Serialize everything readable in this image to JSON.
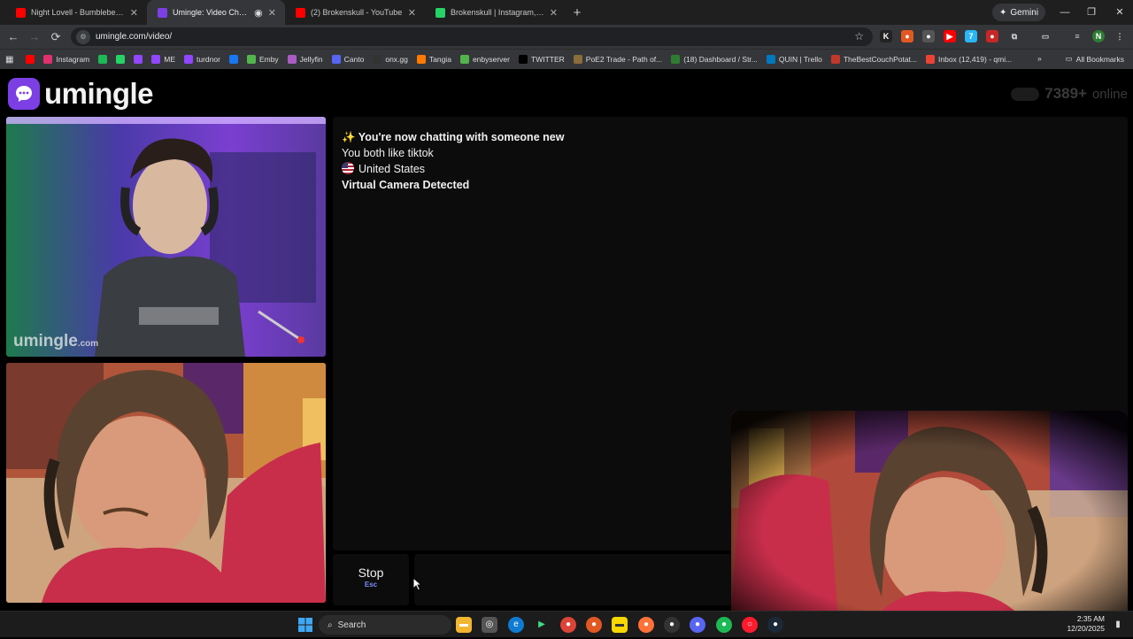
{
  "browser": {
    "tabs": [
      {
        "title": "Night Lovell - Bumblebee (KEIF",
        "color": "#ff0000",
        "active": false
      },
      {
        "title": "Umingle: Video Chat with S",
        "color": "#7b3fe4",
        "active": true
      },
      {
        "title": "(2) Brokenskull - YouTube",
        "color": "#ff0000",
        "active": false
      },
      {
        "title": "Brokenskull | Instagram, TikTok,",
        "color": "#25d366",
        "active": false
      }
    ],
    "new_tab": "+",
    "gemini_label": "Gemini",
    "url": "umingle.com/video/",
    "bookmarks": [
      {
        "label": "",
        "color": "#ff0000"
      },
      {
        "label": "Instagram",
        "color": "#e1306c"
      },
      {
        "label": "",
        "color": "#1db954"
      },
      {
        "label": "",
        "color": "#25d366"
      },
      {
        "label": "",
        "color": "#9146ff"
      },
      {
        "label": "ME",
        "color": "#9146ff"
      },
      {
        "label": "turdnor",
        "color": "#9146ff"
      },
      {
        "label": "",
        "color": "#1877f2"
      },
      {
        "label": "Emby",
        "color": "#52b54b"
      },
      {
        "label": "Jellyfin",
        "color": "#aa5cc3"
      },
      {
        "label": "Canto",
        "color": "#5865f2"
      },
      {
        "label": "onx.gg",
        "color": "#333333"
      },
      {
        "label": "Tangia",
        "color": "#ff7a00"
      },
      {
        "label": "enbyserver",
        "color": "#52b54b"
      },
      {
        "label": "TWITTER",
        "color": "#000000"
      },
      {
        "label": "PoE2 Trade - Path of...",
        "color": "#8a6d3b"
      },
      {
        "label": "(18) Dashboard / Str...",
        "color": "#2e7d32"
      },
      {
        "label": "QUIN | Trello",
        "color": "#0079bf"
      },
      {
        "label": "TheBestCouchPotat...",
        "color": "#c0392b"
      },
      {
        "label": "Inbox (12,419) - qmi...",
        "color": "#ea4335"
      }
    ],
    "all_bookmarks": "All Bookmarks"
  },
  "site": {
    "brand": "umingle",
    "online_count": "7389+",
    "online_label": "online",
    "watermark": "umingle",
    "watermark_suffix": ".com",
    "accent": "#7b3fe4"
  },
  "chat": {
    "messages": [
      {
        "text": "✨ You're now chatting with someone new",
        "style": "bold"
      },
      {
        "text": "You both like tiktok",
        "style": "normal"
      },
      {
        "text": "United States",
        "style": "flag"
      },
      {
        "text": "Virtual Camera Detected",
        "style": "bold"
      }
    ],
    "stop_label": "Stop",
    "stop_shortcut": "Esc"
  },
  "taskbar": {
    "search_label": "Search",
    "time": "2:35 AM",
    "date": "12/20/2025"
  }
}
